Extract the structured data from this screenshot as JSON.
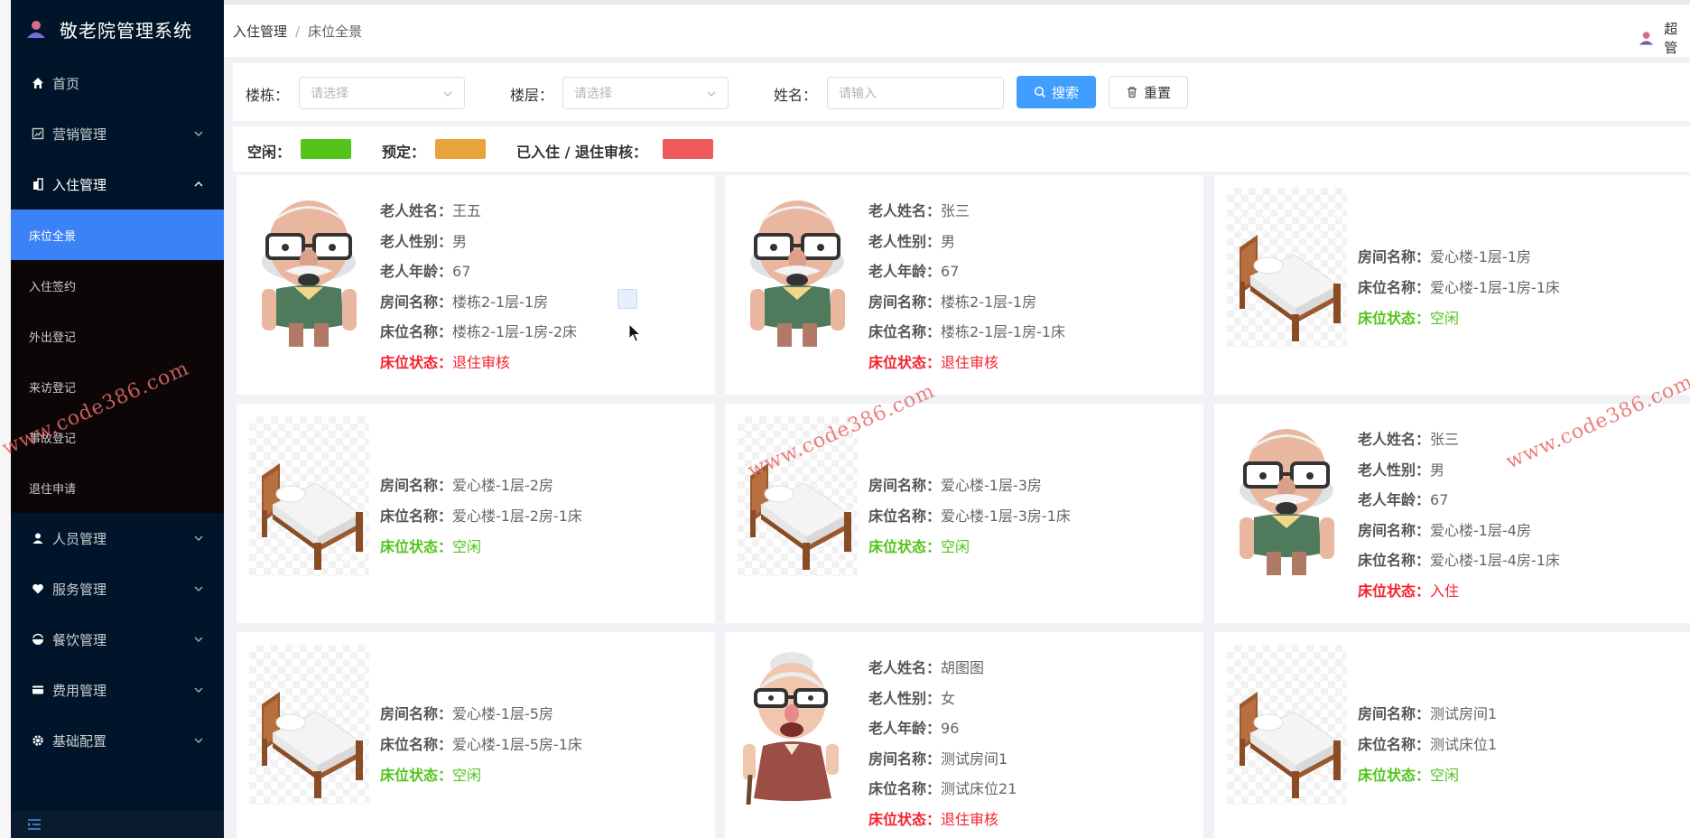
{
  "app": {
    "title": "敬老院管理系统"
  },
  "sidebar": {
    "menu": [
      {
        "label": "首页",
        "icon": "home-icon"
      },
      {
        "label": "营销管理",
        "icon": "marketing-icon"
      },
      {
        "label": "入住管理",
        "icon": "checkin-icon",
        "open": true
      },
      {
        "label": "人员管理",
        "icon": "person-icon"
      },
      {
        "label": "服务管理",
        "icon": "service-icon"
      },
      {
        "label": "餐饮管理",
        "icon": "food-icon"
      },
      {
        "label": "费用管理",
        "icon": "wallet-icon"
      },
      {
        "label": "基础配置",
        "icon": "gear-icon"
      }
    ],
    "submenu": [
      {
        "label": "床位全景",
        "active": true
      },
      {
        "label": "入住签约"
      },
      {
        "label": "外出登记"
      },
      {
        "label": "来访登记"
      },
      {
        "label": "事故登记"
      },
      {
        "label": "退住申请"
      }
    ]
  },
  "header": {
    "breadcrumb": [
      "入住管理",
      "床位全景"
    ],
    "user": "超管"
  },
  "filter": {
    "building_label": "楼栋：",
    "building_placeholder": "请选择",
    "floor_label": "楼层：",
    "floor_placeholder": "请选择",
    "name_label": "姓名：",
    "name_placeholder": "请输入",
    "search_label": "搜索",
    "reset_label": "重置"
  },
  "legend": {
    "free_label": "空闲：",
    "reserved_label": "预定：",
    "occupied_label": "已入住 / 退住审核：",
    "colors": {
      "free": "#52c41a",
      "reserved": "#e8a33a",
      "occupied": "#ef5b5b"
    }
  },
  "labels": {
    "name": "老人姓名：",
    "gender": "老人性别：",
    "age": "老人年龄：",
    "room": "房间名称：",
    "bed": "床位名称：",
    "status": "床位状态："
  },
  "beds": [
    {
      "type": "occupied",
      "avatar": "elderly-man",
      "name": "王五",
      "gender": "男",
      "age": "67",
      "room": "楼栋2-1层-1房",
      "bed": "楼栋2-1层-1房-2床",
      "status": "退住审核"
    },
    {
      "type": "occupied",
      "avatar": "elderly-man",
      "name": "张三",
      "gender": "男",
      "age": "67",
      "room": "楼栋2-1层-1房",
      "bed": "楼栋2-1层-1房-1床",
      "status": "退住审核"
    },
    {
      "type": "empty",
      "room": "爱心楼-1层-1房",
      "bed": "爱心楼-1层-1房-1床",
      "status": "空闲"
    },
    {
      "type": "empty",
      "room": "爱心楼-1层-2房",
      "bed": "爱心楼-1层-2房-1床",
      "status": "空闲"
    },
    {
      "type": "empty",
      "room": "爱心楼-1层-3房",
      "bed": "爱心楼-1层-3房-1床",
      "status": "空闲"
    },
    {
      "type": "occupied",
      "avatar": "elderly-man",
      "name": "张三",
      "gender": "男",
      "age": "67",
      "room": "爱心楼-1层-4房",
      "bed": "爱心楼-1层-4房-1床",
      "status": "入住"
    },
    {
      "type": "empty",
      "room": "爱心楼-1层-5房",
      "bed": "爱心楼-1层-5房-1床",
      "status": "空闲"
    },
    {
      "type": "occupied",
      "avatar": "elderly-woman",
      "name": "胡图图",
      "gender": "女",
      "age": "96",
      "room": "测试房间1",
      "bed": "测试床位21",
      "status": "退住审核"
    },
    {
      "type": "empty",
      "room": "测试房间1",
      "bed": "测试床位1",
      "status": "空闲"
    }
  ],
  "watermark": "www.code386.com"
}
